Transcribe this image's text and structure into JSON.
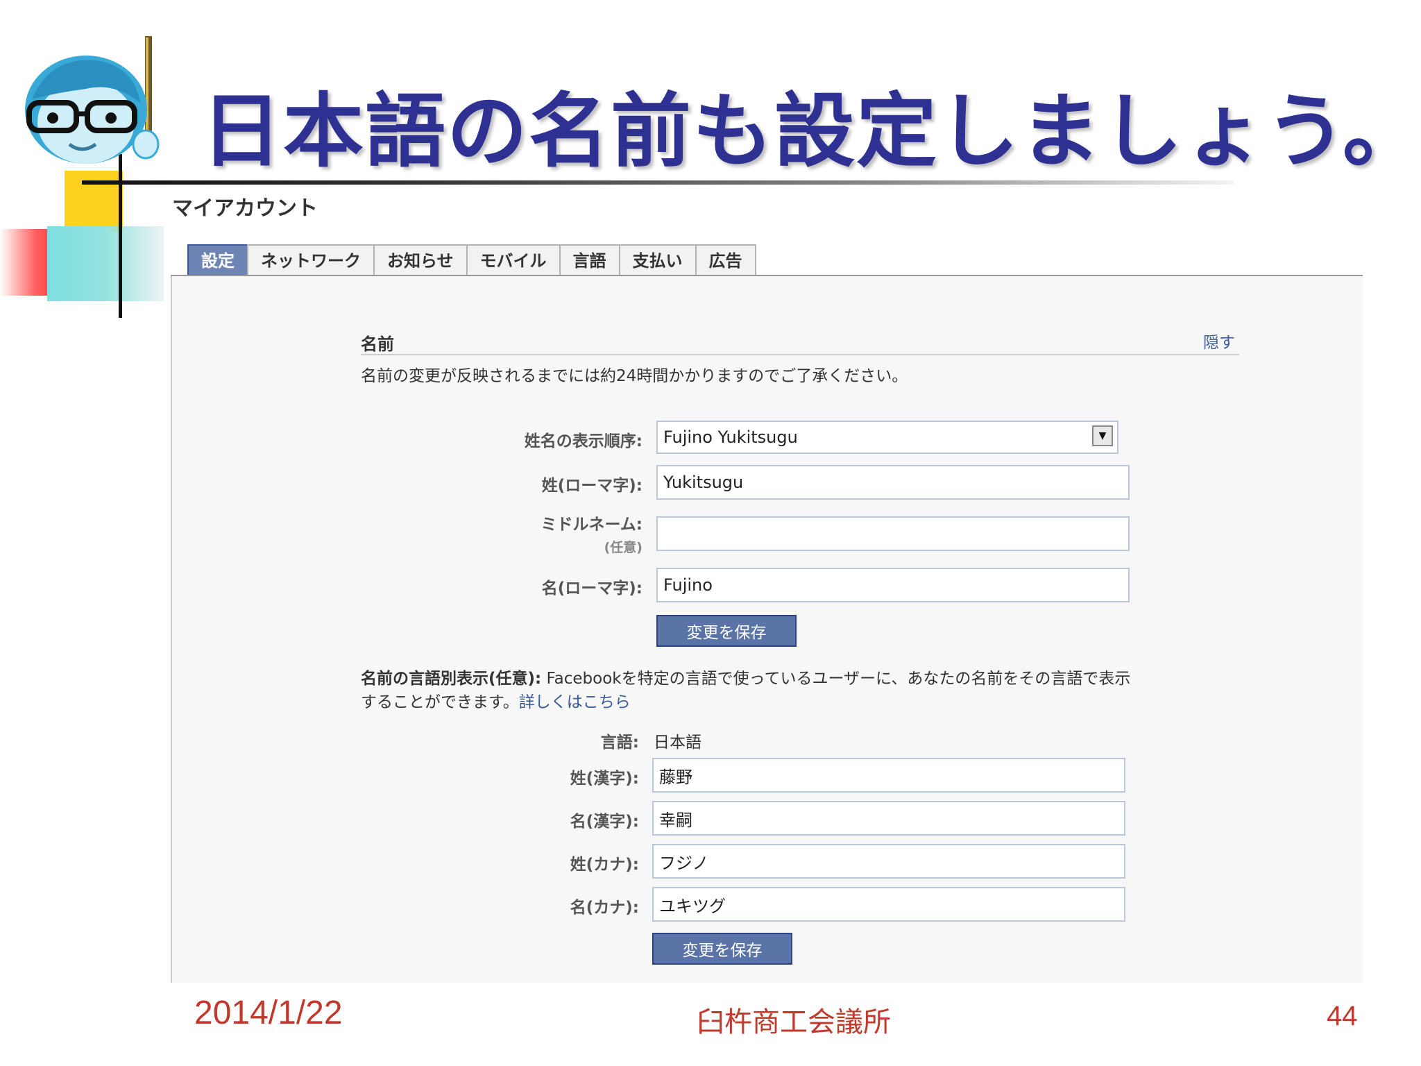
{
  "slide": {
    "title": "日本語の名前も設定しましょう。",
    "date": "2014/1/22",
    "organization": "臼杵商工会議所",
    "page_number": "44"
  },
  "account": {
    "title": "マイアカウント",
    "tabs": [
      "設定",
      "ネットワーク",
      "お知らせ",
      "モバイル",
      "言語",
      "支払い",
      "広告"
    ],
    "active_tab": "設定"
  },
  "name_section": {
    "heading": "名前",
    "hide_link": "隠す",
    "notice": "名前の変更が反映されるまでには約24時間かかりますのでご了承ください。",
    "display_order_label": "姓名の表示順序:",
    "display_order_value": "Fujino Yukitsugu",
    "last_name_label": "姓(ローマ字):",
    "last_name_value": "Yukitsugu",
    "middle_name_label": "ミドルネーム:",
    "middle_name_optional": "(任意)",
    "middle_name_value": "",
    "first_name_label": "名(ローマ字):",
    "first_name_value": "Fujino",
    "save_label": "変更を保存"
  },
  "alt_name_section": {
    "heading": "名前の言語別表示(任意):",
    "description_line1": "Facebookを特定の言語で使っているユーザーに、あなたの名前をその言語で表示",
    "description_line2": "することができます。",
    "learn_more": "詳しくはこちら",
    "language_label": "言語:",
    "language_value": "日本語",
    "last_kanji_label": "姓(漢字):",
    "last_kanji_value": "藤野",
    "first_kanji_label": "名(漢字):",
    "first_kanji_value": "幸嗣",
    "last_kana_label": "姓(カナ):",
    "last_kana_value": "フジノ",
    "first_kana_label": "名(カナ):",
    "first_kana_value": "ユキツグ",
    "save_label": "変更を保存"
  },
  "icons": {
    "avatar": "cartoon-man-with-glasses",
    "select": "dropdown-arrow"
  },
  "colors": {
    "title": "#2e3192",
    "footer": "#c0392b",
    "active_tab": "#6d84b4",
    "button": "#5b74a8",
    "link": "#3b5998"
  }
}
